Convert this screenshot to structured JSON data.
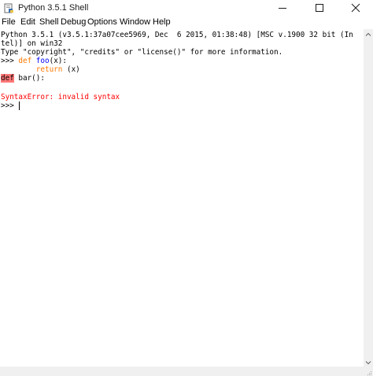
{
  "window": {
    "title": "Python 3.5.1 Shell",
    "icon": "python-idle-icon"
  },
  "menu": {
    "items": [
      "File",
      "Edit",
      "Shell",
      "Debug",
      "Options",
      "Window",
      "Help"
    ]
  },
  "shell": {
    "banner_line1": "Python 3.5.1 (v3.5.1:37a07cee5969, Dec  6 2015, 01:38:48) [MSC v.1900 32 bit (In",
    "banner_line2": "tel)] on win32",
    "banner_line3": "Type \"copyright\", \"credits\" or \"license()\" for more information.",
    "prompt": ">>> ",
    "line4_kw": "def",
    "line4_name": "foo",
    "line4_rest": "(x):",
    "line5_indent": "        ",
    "line5_kw": "return",
    "line5_rest": " (x)",
    "line6_kw_error": "def",
    "line6_rest": " bar():",
    "error_message": "SyntaxError: invalid syntax",
    "final_prompt": ">>> "
  },
  "colors": {
    "keyword": "#ff7700",
    "definition": "#0000ff",
    "error": "#ff0000",
    "error_highlight": "#ff7777"
  }
}
